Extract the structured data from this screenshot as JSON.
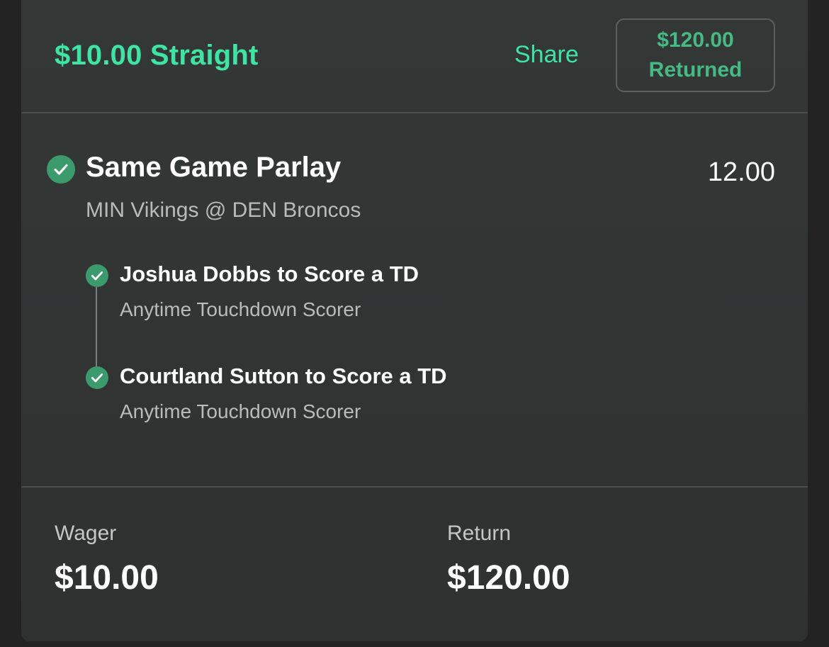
{
  "header": {
    "bet_title": "$10.00 Straight",
    "share_label": "Share",
    "returned_amount": "$120.00",
    "returned_label": "Returned"
  },
  "parlay": {
    "title": "Same Game Parlay",
    "odds": "12.00",
    "matchup": "MIN Vikings @ DEN Broncos",
    "legs": [
      {
        "title": "Joshua Dobbs to Score a TD",
        "market": "Anytime Touchdown Scorer"
      },
      {
        "title": "Courtland Sutton to Score a TD",
        "market": "Anytime Touchdown Scorer"
      }
    ]
  },
  "footer": {
    "wager_label": "Wager",
    "wager_value": "$10.00",
    "return_label": "Return",
    "return_value": "$120.00"
  },
  "colors": {
    "accent_green": "#3fe3a4",
    "check_green": "#3c9b6c",
    "returned_green": "#46b985"
  },
  "icons": {
    "won_status": "check-circle-icon"
  }
}
